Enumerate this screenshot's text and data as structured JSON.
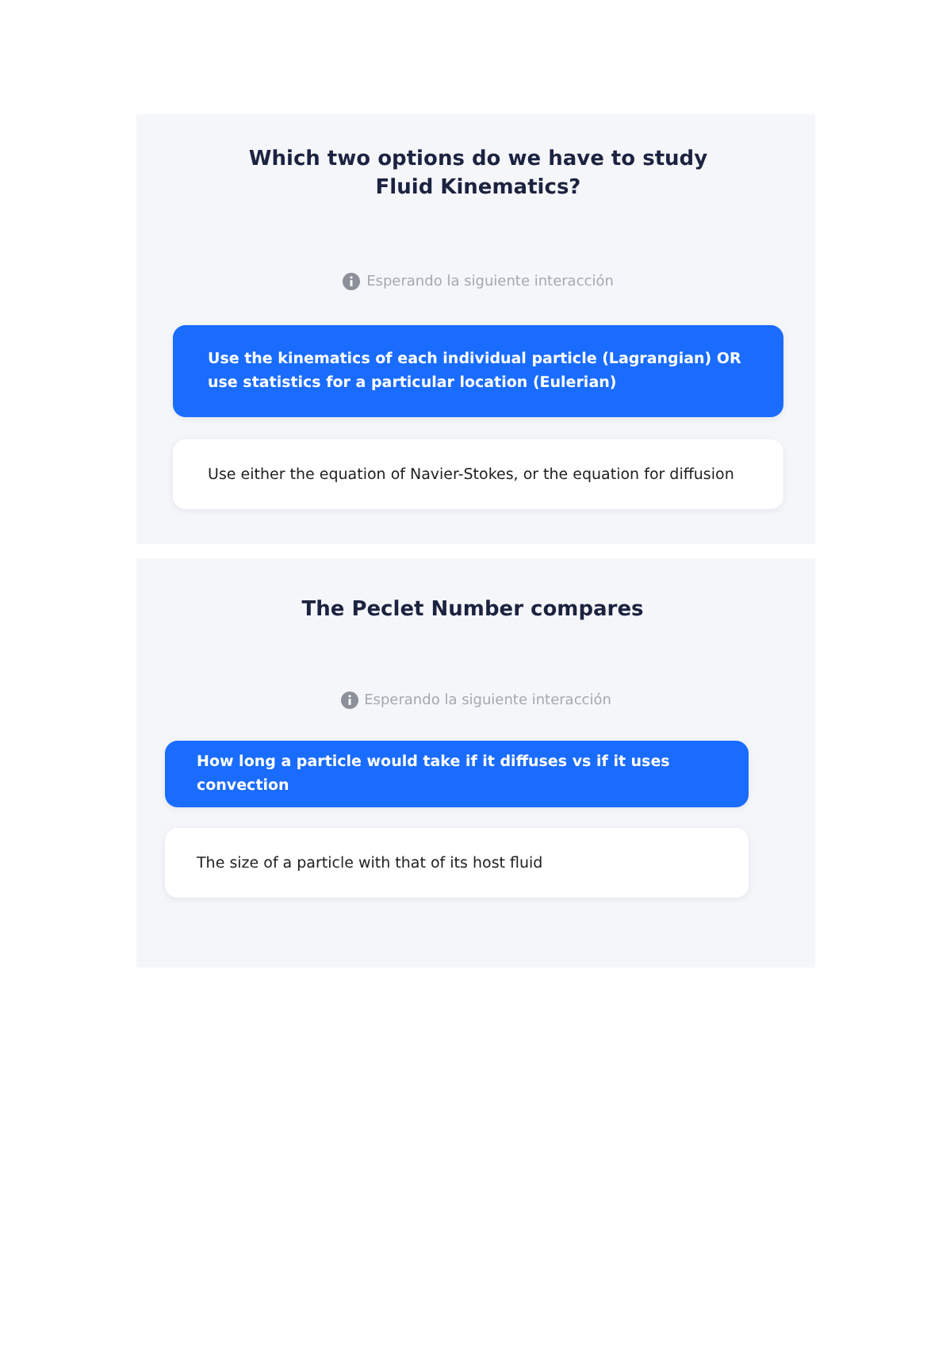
{
  "questions": [
    {
      "title": "Which two options do we have to study Fluid Kinematics?",
      "status": "Esperando la siguiente interacción",
      "options": [
        {
          "text": "Use the kinematics of each individual particle (Lagrangian) OR use statistics for a particular location (Eulerian)",
          "selected": true
        },
        {
          "text": "Use either the equation of Navier-Stokes, or the equation for diffusion",
          "selected": false
        }
      ]
    },
    {
      "title": "The Peclet Number compares",
      "status": "Esperando la siguiente interacción",
      "options": [
        {
          "text": "How long a particle would take if it diffuses vs if it uses convection",
          "selected": true
        },
        {
          "text": "The size of a particle with that of its host fluid",
          "selected": false
        }
      ]
    }
  ]
}
